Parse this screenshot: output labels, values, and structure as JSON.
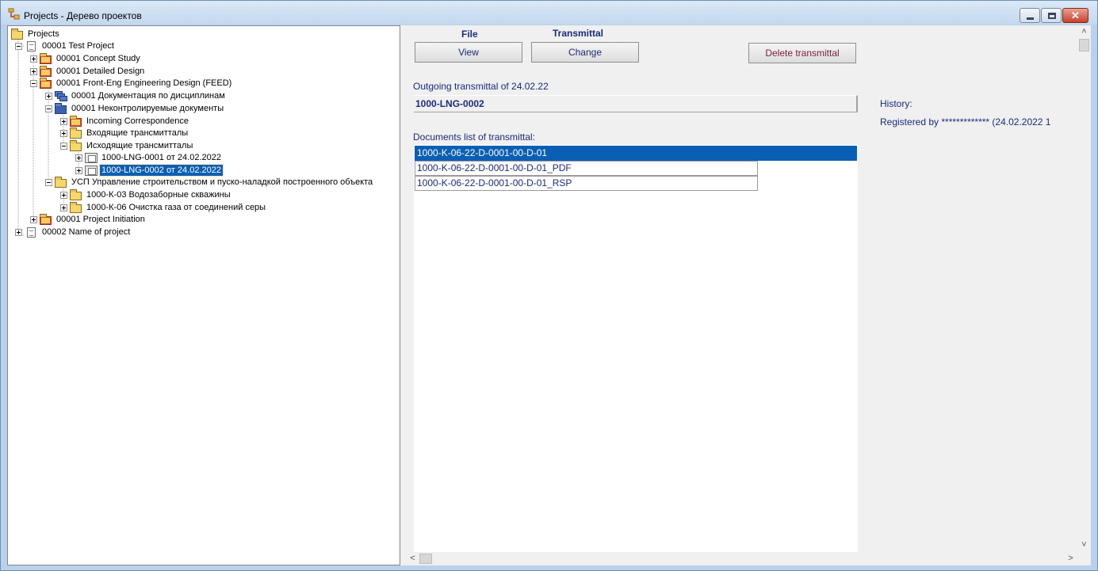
{
  "window": {
    "title": "Projects - Дерево проектов",
    "icon": "project-tree-icon"
  },
  "tree": {
    "nodes": [
      {
        "label": "Projects",
        "icon": "folder-icon"
      },
      {
        "label": "00001   Test Project",
        "icon": "document-icon"
      },
      {
        "label": "00001 Concept Study",
        "icon": "folder-icon"
      },
      {
        "label": "00001 Detailed Design",
        "icon": "folder-icon"
      },
      {
        "label": "00001 Front-Eng Engineering Design (FEED)",
        "icon": "folder-icon"
      },
      {
        "label": "00001 Документация по дисциплинам",
        "icon": "document-stack-icon"
      },
      {
        "label": "00001 Неконтролируемые документы",
        "icon": "folder-icon"
      },
      {
        "label": "Incoming Correspondence",
        "icon": "folder-icon"
      },
      {
        "label": "Входящие трансмитталы",
        "icon": "folder-icon"
      },
      {
        "label": "Исходящие трансмитталы",
        "icon": "folder-icon"
      },
      {
        "label": "1000-LNG-0001 от 24.02.2022",
        "icon": "transmittal-icon"
      },
      {
        "label": "1000-LNG-0002 от 24.02.2022",
        "icon": "transmittal-icon"
      },
      {
        "label": "УСП Управление строительством и пуско-наладкой построенного объекта",
        "icon": "folder-icon"
      },
      {
        "label": "1000-К-03 Водозаборные скважины",
        "icon": "folder-icon"
      },
      {
        "label": "1000-К-06 Очистка газа от соединений серы",
        "icon": "folder-icon"
      },
      {
        "label": "00001 Project Initiation",
        "icon": "folder-icon"
      },
      {
        "label": "00002    Name of project",
        "icon": "document-icon"
      }
    ],
    "selected": "1000-LNG-0002 от 24.02.2022"
  },
  "toolbar": {
    "file_header": "File",
    "transmittal_header": "Transmittal",
    "view_label": "View",
    "change_label": "Change",
    "delete_label": "Delete transmittal"
  },
  "transmittal": {
    "outgoing_label": "Outgoing transmittal of  24.02.22",
    "number": "1000-LNG-0002",
    "documents_label": "Documents list of transmittal:",
    "documents": [
      "1000-K-06-22-D-0001-00-D-01",
      "1000-K-06-22-D-0001-00-D-01_PDF",
      "1000-K-06-22-D-0001-00-D-01_RSP"
    ]
  },
  "history": {
    "label": "History:",
    "text": "Registered by ************* (24.02.2022 1"
  },
  "scroll": {
    "up": "˄",
    "down": "˅",
    "left": "<",
    "right": ">"
  }
}
